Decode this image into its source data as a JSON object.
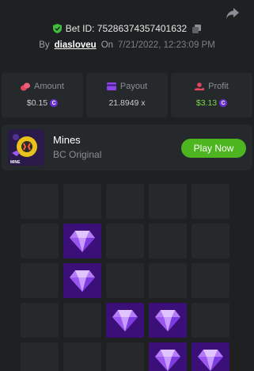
{
  "header": {
    "bet_id": "Bet ID: 75286374357401632",
    "by_label": "By",
    "username": "diasloveu",
    "on_label": "On",
    "datetime": "7/21/2022, 12:23:09 PM"
  },
  "stats": [
    {
      "label": "Amount",
      "value": "$0.15",
      "icon": "coins-icon",
      "color": "#e2465a",
      "has_coin": true
    },
    {
      "label": "Payout",
      "value": "21.8949 x",
      "icon": "payout-card-icon",
      "color": "#8a44e8",
      "has_coin": false
    },
    {
      "label": "Profit",
      "value": "$3.13",
      "icon": "profit-hand-icon",
      "color": "#e2465a",
      "has_coin": true
    }
  ],
  "coin_symbol": "C",
  "game": {
    "name": "Mines",
    "subtitle": "BC Original",
    "play_label": "Play Now",
    "thumb_label": "MINE"
  },
  "board": {
    "rows": 5,
    "cols": 5,
    "gems": [
      [
        1,
        1
      ],
      [
        2,
        1
      ],
      [
        3,
        2
      ],
      [
        3,
        3
      ],
      [
        4,
        3
      ],
      [
        4,
        4
      ]
    ]
  },
  "colors": {
    "background": "#1e2022",
    "card": "#26292c",
    "gem_tile": "#3a0f78",
    "play_button": "#4cb51f",
    "profit_text": "#7bd845"
  }
}
